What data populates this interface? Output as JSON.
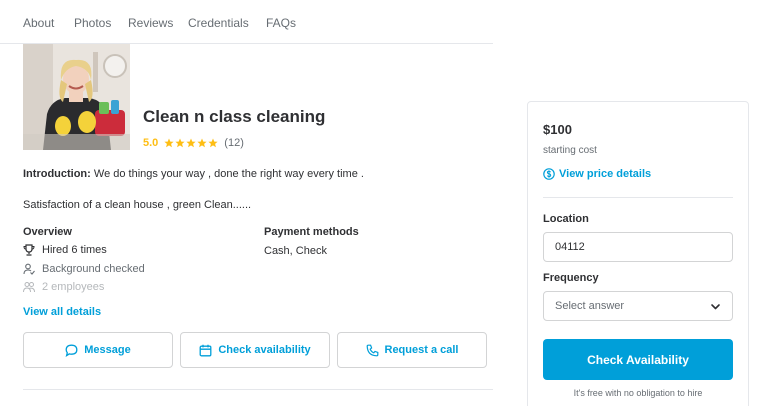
{
  "nav": {
    "items": [
      "About",
      "Photos",
      "Reviews",
      "Credentials",
      "FAQs"
    ]
  },
  "business": {
    "name": "Clean n class cleaning",
    "rating": "5.0",
    "star_count": 5,
    "review_count": "(12)",
    "intro_label": "Introduction:",
    "intro_text": " We do things your way , done the right way every time .",
    "intro_text_2": "Satisfaction of a clean house , green Clean......"
  },
  "overview": {
    "title": "Overview",
    "items": [
      {
        "icon": "trophy-icon",
        "text": "Hired 6 times"
      },
      {
        "icon": "person-check-icon",
        "text": "Background checked"
      },
      {
        "icon": "people-icon",
        "text": "2 employees"
      }
    ]
  },
  "payment": {
    "title": "Payment methods",
    "value": "Cash, Check"
  },
  "view_all_label": "View all details",
  "actions": {
    "message": "Message",
    "check": "Check availability",
    "call": "Request a call"
  },
  "sidebar": {
    "price": "$100",
    "price_sub": "starting cost",
    "price_link": "View price details",
    "location_label": "Location",
    "location_value": "04112",
    "frequency_label": "Frequency",
    "frequency_value": "Select answer",
    "cta": "Check Availability",
    "cta_note": "It's free with no obligation to hire"
  },
  "colors": {
    "accent": "#009fd9",
    "star": "#febe14",
    "text": "#2f3033",
    "muted": "#676d73"
  }
}
